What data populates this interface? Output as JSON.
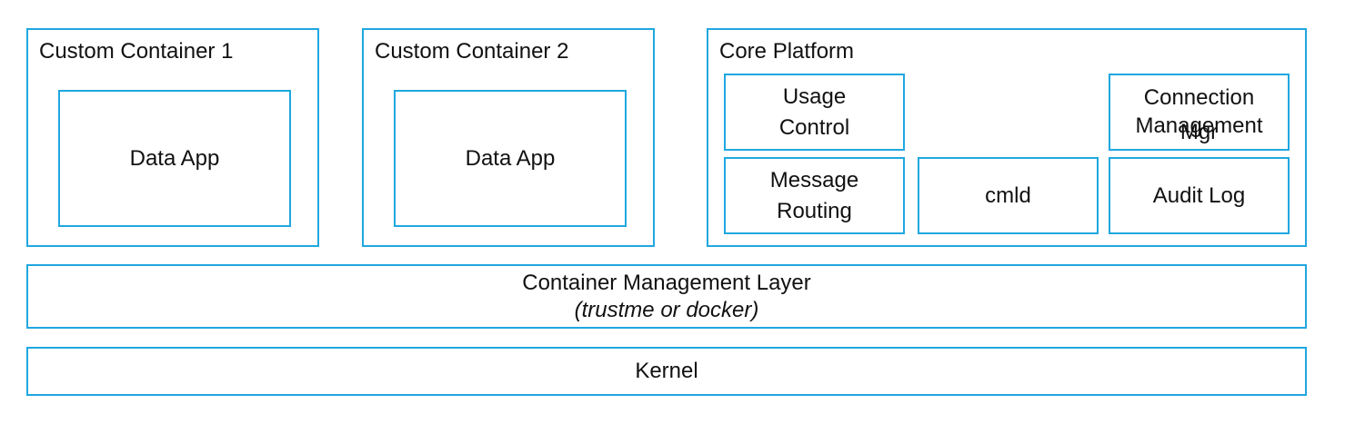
{
  "containers": {
    "custom1": {
      "title": "Custom Container 1",
      "app": "Data App"
    },
    "custom2": {
      "title": "Custom Container 2",
      "app": "Data App"
    }
  },
  "core": {
    "title": "Core Platform",
    "usage_control": [
      "Usage",
      "Control"
    ],
    "message_routing": [
      "Message",
      "Routing"
    ],
    "cmld": "cmld",
    "connection": {
      "line1": "Connection",
      "line2a": "Management",
      "line2b": "Mgr"
    },
    "audit_log": "Audit Log"
  },
  "layers": {
    "cml": {
      "title": "Container Management Layer",
      "subtitle": "(trustme or docker)"
    },
    "kernel": "Kernel"
  },
  "colors": {
    "border": "#1fa7e0",
    "text": "#111111",
    "background": "#ffffff"
  }
}
